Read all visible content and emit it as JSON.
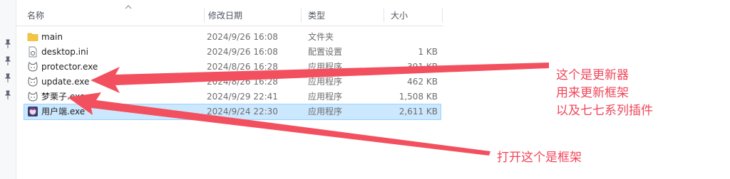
{
  "columns": {
    "name": "名称",
    "date": "修改日期",
    "type": "类型",
    "size": "大小"
  },
  "files": [
    {
      "name": "main",
      "date": "2024/9/26 16:08",
      "type": "文件夹",
      "size": "",
      "icon": "folder-icon"
    },
    {
      "name": "desktop.ini",
      "date": "2024/9/26 16:08",
      "type": "配置设置",
      "size": "1 KB",
      "icon": "settings-file-icon"
    },
    {
      "name": "protector.exe",
      "date": "2024/8/26 16:28",
      "type": "应用程序",
      "size": "391 KB",
      "icon": "cat-app-icon"
    },
    {
      "name": "update.exe",
      "date": "2024/8/26 16:28",
      "type": "应用程序",
      "size": "462 KB",
      "icon": "cat-app-icon"
    },
    {
      "name": "梦栗子.exe",
      "date": "2024/9/29 22:41",
      "type": "应用程序",
      "size": "1,508 KB",
      "icon": "cat-app-icon"
    },
    {
      "name": "用户端.exe",
      "date": "2024/9/24 22:30",
      "type": "应用程序",
      "size": "2,611 KB",
      "icon": "anime-app-icon"
    }
  ],
  "annotations": {
    "line1": "这个是更新器",
    "line2": "用来更新框架",
    "line3": "以及七七系列插件",
    "bottom": "打开这个是框架"
  },
  "colors": {
    "annotation": "#f0465a",
    "selection": "#cce8ff",
    "folder": "#f4c542"
  }
}
